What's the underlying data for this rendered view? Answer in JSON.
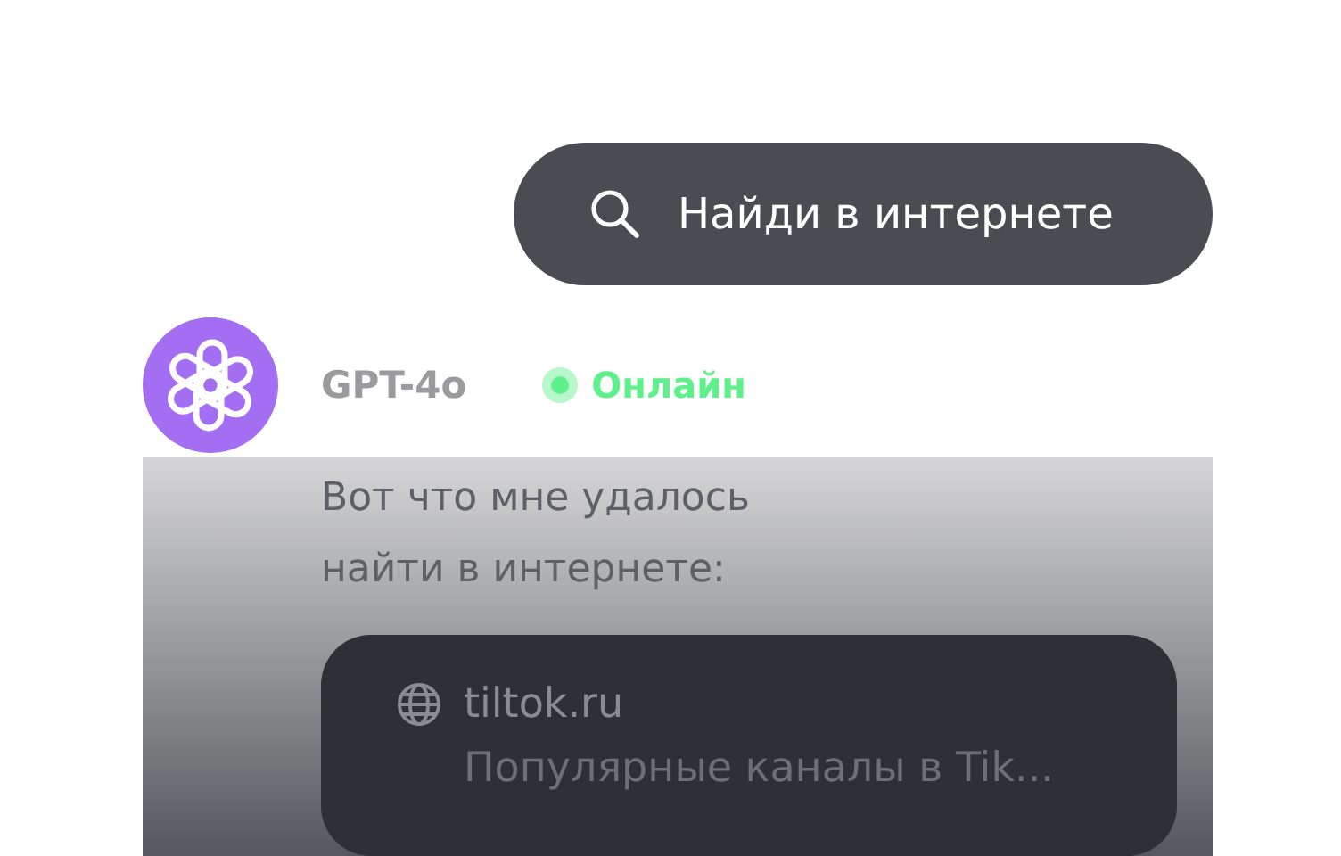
{
  "search_button": {
    "label": "Найди в интернете"
  },
  "message": {
    "sender": "GPT-4o",
    "status": {
      "label": "Онлайн",
      "online": true,
      "color": "#5ef08a"
    },
    "text": "Вот что мне удалось найти в интернете:",
    "result": {
      "site": "tiltok.ru",
      "title": "Популярные каналы в Tik..."
    }
  }
}
